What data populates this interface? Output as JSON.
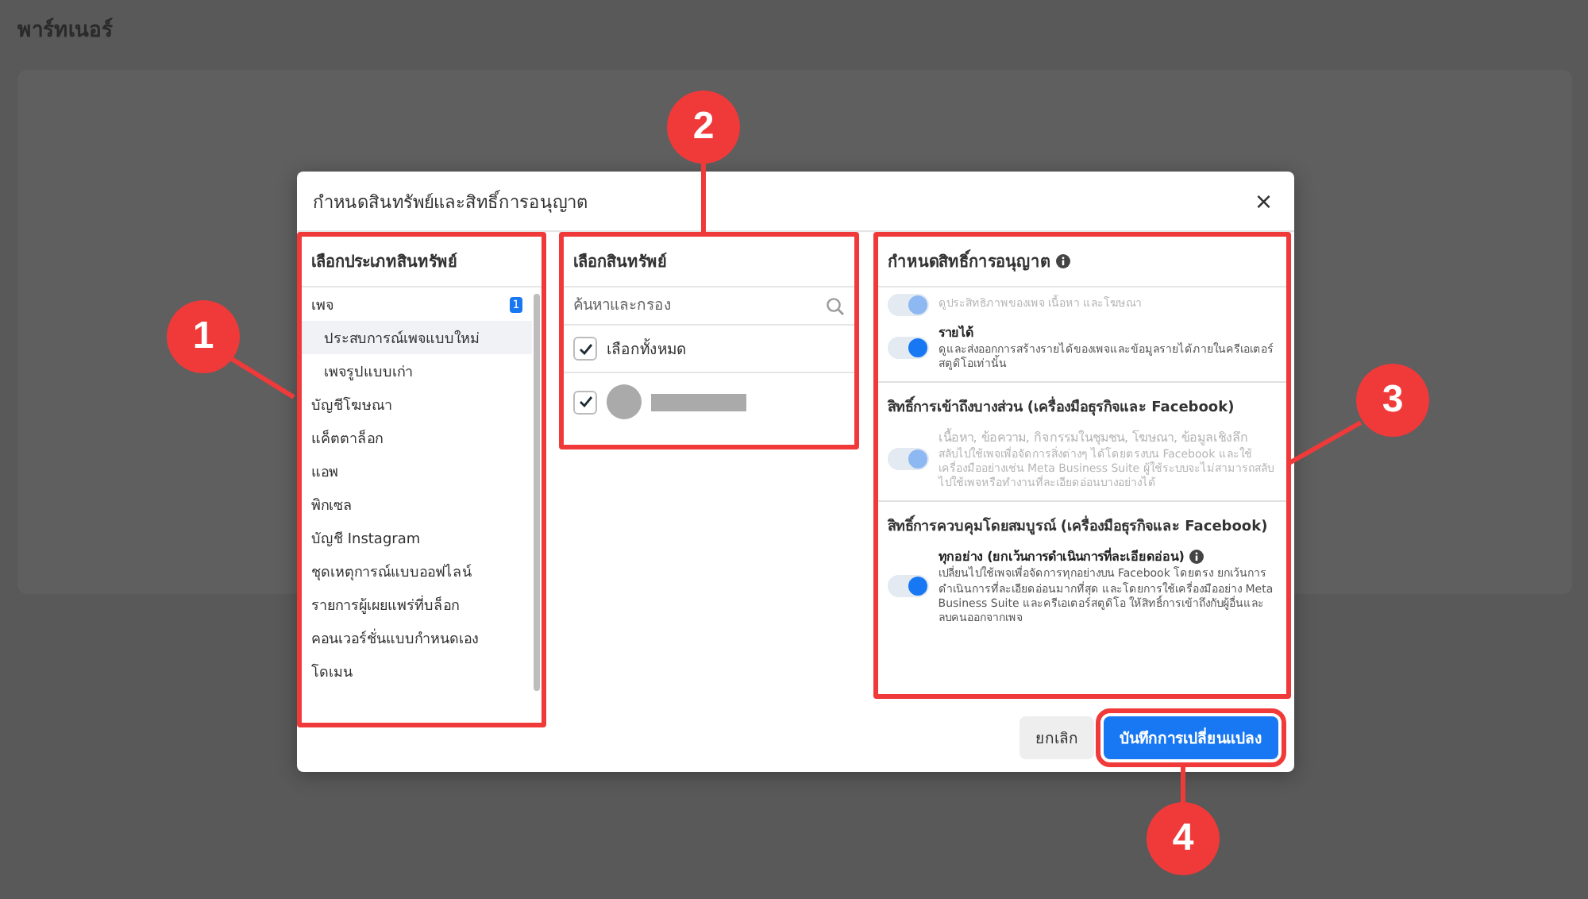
{
  "page": {
    "title": "พาร์ทเนอร์"
  },
  "dialog": {
    "title": "กำหนดสินทรัพย์และสิทธิ์การอนุญาต",
    "close": "×",
    "asset_types": {
      "heading": "เลือกประเภทสินทรัพย์",
      "highlighted": true,
      "items": [
        {
          "label": "เพจ",
          "badge": "1",
          "selected": false,
          "children": [
            {
              "label": "ประสบการณ์เพจแบบใหม่",
              "selected": true
            },
            {
              "label": "เพจรูปแบบเก่า",
              "selected": false
            }
          ]
        },
        {
          "label": "บัญชีโฆษณา",
          "selected": false
        },
        {
          "label": "แค็ตตาล็อก",
          "selected": false
        },
        {
          "label": "แอพ",
          "selected": false
        },
        {
          "label": "พิกเซล",
          "selected": false
        },
        {
          "label": "บัญชี Instagram",
          "selected": false
        },
        {
          "label": "ชุดเหตุการณ์แบบออฟไลน์",
          "selected": false
        },
        {
          "label": "รายการผู้เผยแพร่ที่บล็อก",
          "selected": false
        },
        {
          "label": "คอนเวอร์ชั่นแบบกำหนดเอง",
          "selected": false
        },
        {
          "label": "โดเมน",
          "selected": false
        }
      ]
    },
    "assets": {
      "heading": "เลือกสินทรัพย์",
      "highlighted": true,
      "search": {
        "placeholder": "ค้นหาและกรอง"
      },
      "select_all": {
        "label": "เลือกทั้งหมด",
        "checked": true
      },
      "items": [
        {
          "checked": true
        }
      ]
    },
    "permissions": {
      "heading": "กำหนดสิทธิ์การอนุญาต",
      "highlighted": true,
      "sections": [
        {
          "rows": [
            {
              "description": "ดูประสิทธิภาพของเพจ เนื้อหา และโฆษณา",
              "on": true,
              "disabled": true
            },
            {
              "title": "รายได้",
              "description": "ดูและส่งออกการสร้างรายได้ของเพจและข้อมูลรายได้ภายในครีเอเตอร์สตูดิโอเท่านั้น",
              "on": true,
              "disabled": false
            }
          ]
        },
        {
          "heading": "สิทธิ์การเข้าถึงบางส่วน (เครื่องมือธุรกิจและ Facebook)",
          "rows": [
            {
              "title": "เนื้อหา, ข้อความ, กิจกรรมในชุมชน, โฆษณา, ข้อมูลเชิงลึก",
              "description": "สลับไปใช้เพจเพื่อจัดการสิ่งต่างๆ ได้โดยตรงบน Facebook และใช้เครื่องมืออย่างเช่น Meta Business Suite ผู้ใช้ระบบจะไม่สามารถสลับไปใช้เพจหรือทำงานที่ละเอียดอ่อนบางอย่างได้",
              "on": true,
              "disabled": true
            }
          ]
        },
        {
          "heading": "สิทธิ์การควบคุมโดยสมบูรณ์ (เครื่องมือธุรกิจและ Facebook)",
          "rows": [
            {
              "title": "ทุกอย่าง (ยกเว้นการดำเนินการที่ละเอียดอ่อน)",
              "info": true,
              "description": "เปลี่ยนไปใช้เพจเพื่อจัดการทุกอย่างบน Facebook โดยตรง ยกเว้นการดำเนินการที่ละเอียดอ่อนมากที่สุด และโดยการใช้เครื่องมืออย่าง Meta Business Suite และครีเอเตอร์สตูดิโอ ให้สิทธิ์การเข้าถึงกับผู้อื่นและลบคนออกจากเพจ",
              "on": true,
              "disabled": false
            }
          ]
        }
      ]
    },
    "buttons": [
      {
        "label": "ยกเลิก",
        "kind": "secondary",
        "highlighted": false
      },
      {
        "label": "บันทึกการเปลี่ยนแปลง",
        "kind": "primary",
        "highlighted": true
      }
    ]
  },
  "callouts": [
    {
      "number": "1"
    },
    {
      "number": "2"
    },
    {
      "number": "3"
    },
    {
      "number": "4"
    }
  ]
}
